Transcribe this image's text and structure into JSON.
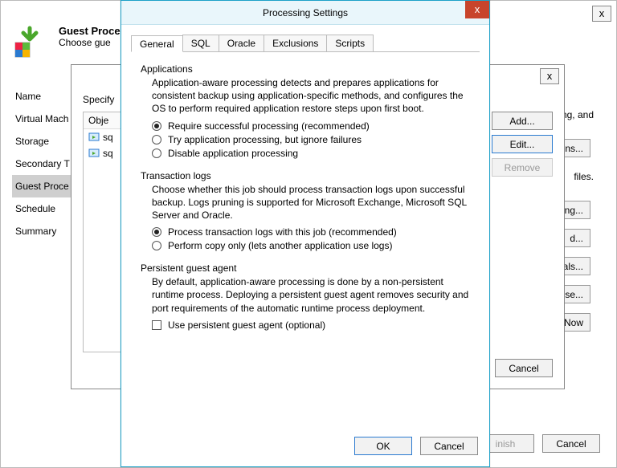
{
  "bg": {
    "title": "Guest Processing",
    "subtitle": "Choose gue",
    "close": "x",
    "sidebar": [
      "Name",
      "Virtual Mach",
      "Storage",
      "Secondary T",
      "Guest Proce",
      "Schedule",
      "Summary"
    ],
    "right_fragments": [
      "ng, and"
    ],
    "right_buttons": [
      "tions...",
      "",
      "ng...",
      "d...",
      "tials...",
      "se...",
      "Now"
    ],
    "right_text1": "files.",
    "footer": {
      "finish": "inish",
      "cancel": "Cancel"
    }
  },
  "mid": {
    "close": "x",
    "specify": "Specify",
    "list_header": "Obje",
    "items": [
      "sq",
      "sq"
    ],
    "buttons": {
      "add": "Add...",
      "edit": "Edit...",
      "remove": "Remove"
    },
    "cancel": "Cancel"
  },
  "dlg": {
    "title": "Processing Settings",
    "close": "x",
    "tabs": [
      "General",
      "SQL",
      "Oracle",
      "Exclusions",
      "Scripts"
    ],
    "sections": {
      "apps": {
        "head": "Applications",
        "desc": "Application-aware processing detects and prepares applications for consistent backup using application-specific methods, and configures the OS to perform required application restore steps upon first boot.",
        "radios": [
          "Require successful processing  (recommended)",
          "Try application processing, but ignore failures",
          "Disable application processing"
        ]
      },
      "tlogs": {
        "head": "Transaction logs",
        "desc": "Choose whether this job should process transaction logs upon successful backup. Logs pruning is supported for Microsoft Exchange, Microsoft SQL Server and Oracle.",
        "radios": [
          "Process transaction logs with this job (recommended)",
          "Perform copy only (lets another application use logs)"
        ]
      },
      "agent": {
        "head": "Persistent guest agent",
        "desc": "By default, application-aware processing is done by a non-persistent runtime process. Deploying a persistent guest agent removes security and port requirements of the automatic runtime process deployment.",
        "check": "Use persistent guest agent (optional)"
      }
    },
    "footer": {
      "ok": "OK",
      "cancel": "Cancel"
    }
  }
}
